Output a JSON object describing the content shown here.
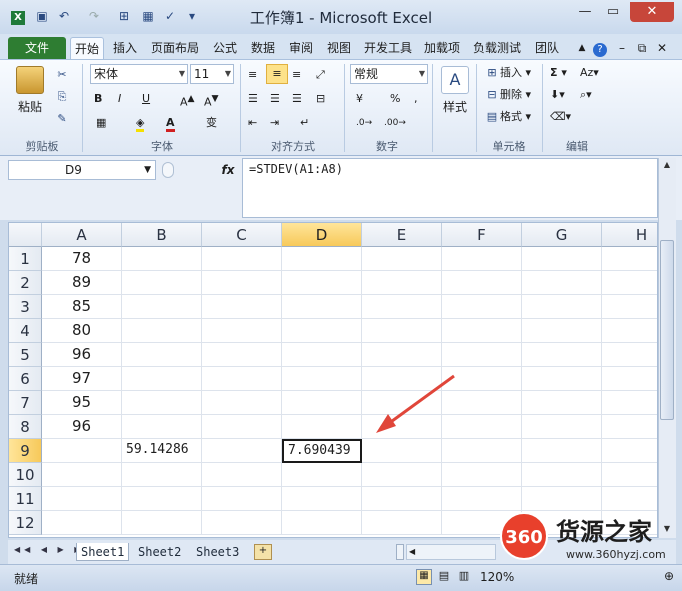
{
  "window": {
    "title": "工作簿1 - Microsoft Excel"
  },
  "tabs": [
    "文件",
    "开始",
    "插入",
    "页面布局",
    "公式",
    "数据",
    "审阅",
    "视图",
    "开发工具",
    "加载项",
    "负载测试",
    "团队"
  ],
  "ribbon": {
    "clipboard": {
      "label": "剪贴板",
      "paste": "粘贴"
    },
    "font": {
      "label": "字体",
      "name": "宋体",
      "size": "11",
      "bold": "B",
      "italic": "I",
      "underline": "U"
    },
    "alignment": {
      "label": "对齐方式"
    },
    "number": {
      "label": "数字",
      "format": "常规",
      "percent": "%",
      "comma": ","
    },
    "styles": {
      "label": "样式"
    },
    "cells": {
      "label": "单元格",
      "insert": "插入",
      "delete": "删除",
      "format": "格式"
    },
    "editing": {
      "label": "编辑",
      "sum": "Σ"
    }
  },
  "formula_bar": {
    "name_box": "D9",
    "fx": "fx",
    "formula": "=STDEV(A1:A8)"
  },
  "grid": {
    "columns": [
      "A",
      "B",
      "C",
      "D",
      "E",
      "F",
      "G",
      "H"
    ],
    "rows": [
      "1",
      "2",
      "3",
      "4",
      "5",
      "6",
      "7",
      "8",
      "9",
      "10",
      "11",
      "12"
    ],
    "colA": [
      "78",
      "89",
      "85",
      "80",
      "96",
      "97",
      "95",
      "96"
    ],
    "b9": "59.14286",
    "d9": "7.690439"
  },
  "sheets": [
    "Sheet1",
    "Sheet2",
    "Sheet3"
  ],
  "status": {
    "ready": "就绪",
    "zoom": "120%"
  },
  "watermark": {
    "logo": "360",
    "brand": "货源之家",
    "url": "www.360hyzj.com"
  },
  "colors": {
    "file_tab": "#2e7d32",
    "selected_header": "#f7c95a",
    "arrow": "#e0463a"
  }
}
